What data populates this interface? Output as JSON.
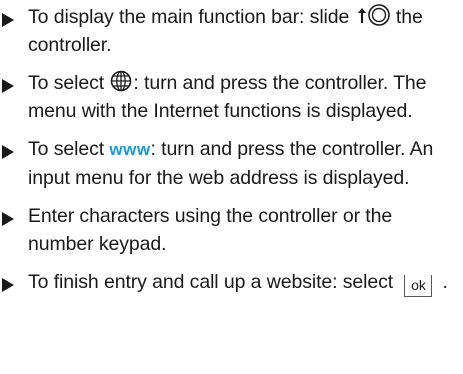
{
  "steps": [
    {
      "before": "To display the main function bar: slide ",
      "after": " the controller.",
      "icon": "slide-up-controller-icon"
    },
    {
      "before": "To select ",
      "after": ": turn and press the controller. The menu with the Internet functions is displayed.",
      "icon": "globe-icon"
    },
    {
      "before": "To select ",
      "symbol_text": "www",
      "after": ": turn and press the controller. An input menu for the web address is displayed."
    },
    {
      "text": "Enter characters using the controller or the number keypad."
    },
    {
      "before": "To finish entry and call up a website: select ",
      "key_label": "ok",
      "after": "."
    }
  ],
  "colors": {
    "text": "#1a1a1a",
    "www_symbol": "#1b9bd4"
  }
}
